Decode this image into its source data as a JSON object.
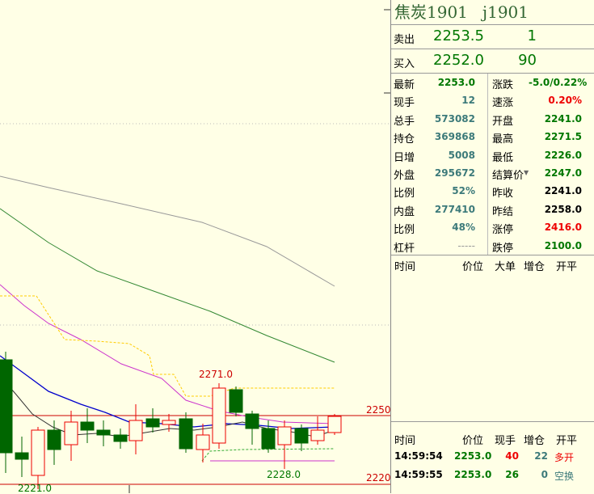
{
  "chart": {
    "price_labels": {
      "high": "2271.0",
      "low_mid": "2228.0",
      "low": "2221.0"
    },
    "axis_labels": {
      "upper": "2250",
      "lower": "2220"
    }
  },
  "quote": {
    "name": "焦炭1901",
    "code": "j1901",
    "sell": {
      "label": "卖出",
      "price": "2253.5",
      "volume": "1"
    },
    "buy": {
      "label": "买入",
      "price": "2252.0",
      "volume": "90"
    }
  },
  "stats": [
    {
      "l1": "最新",
      "v1": "2253.0",
      "c1": "green",
      "l2": "涨跌",
      "v2": "-5.0/0.22%",
      "c2": "green"
    },
    {
      "l1": "现手",
      "v1": "12",
      "c1": "teal",
      "l2": "速涨",
      "v2": "0.20%",
      "c2": "red"
    },
    {
      "l1": "总手",
      "v1": "573082",
      "c1": "teal",
      "l2": "开盘",
      "v2": "2241.0",
      "c2": "green"
    },
    {
      "l1": "持仓",
      "v1": "369868",
      "c1": "teal",
      "l2": "最高",
      "v2": "2271.5",
      "c2": "green"
    },
    {
      "l1": "日增",
      "v1": "5008",
      "c1": "teal",
      "l2": "最低",
      "v2": "2226.0",
      "c2": "green"
    },
    {
      "l1": "外盘",
      "v1": "295672",
      "c1": "teal",
      "l2": "结算价",
      "v2": "2247.0",
      "c2": "green"
    },
    {
      "l1": "比例",
      "v1": "52%",
      "c1": "teal",
      "l2": "昨收",
      "v2": "2241.0",
      "c2": "black"
    },
    {
      "l1": "内盘",
      "v1": "277410",
      "c1": "teal",
      "l2": "昨结",
      "v2": "2258.0",
      "c2": "black"
    },
    {
      "l1": "比例",
      "v1": "48%",
      "c1": "teal",
      "l2": "涨停",
      "v2": "2416.0",
      "c2": "red"
    },
    {
      "l1": "杠杆",
      "v1": "-----",
      "c1": "dim",
      "l2": "跌停",
      "v2": "2100.0",
      "c2": "green"
    }
  ],
  "tick_header_upper": {
    "time": "时间",
    "price": "价位",
    "big": "大单",
    "oi": "增仓",
    "type": "开平"
  },
  "tick_header_lower": {
    "time": "时间",
    "price": "价位",
    "vol": "现手",
    "oi": "增仓",
    "type": "开平"
  },
  "ticks": [
    {
      "time": "14:59:54",
      "price": "2253.0",
      "vol": "40",
      "oi": "22",
      "type": "多开"
    },
    {
      "time": "14:59:55",
      "price": "2253.0",
      "vol": "26",
      "oi": "0",
      "type": "空换"
    }
  ],
  "colors": {
    "up": "#ee0000",
    "down": "#006600",
    "ma5": "#333333",
    "ma10": "#0000cc",
    "ma20": "#cc33cc",
    "ma60": "#338833",
    "ma120": "#999999",
    "boll": "#ffcc00"
  }
}
